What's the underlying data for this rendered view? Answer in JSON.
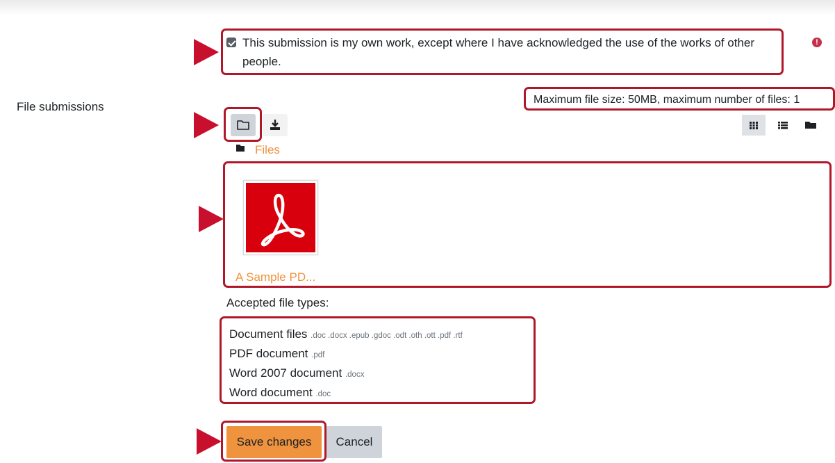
{
  "form": {
    "declaration_text": "This submission is my own work, except where I have acknowledged the use of the works of other people.",
    "declaration_checked": true,
    "field_label": "File submissions"
  },
  "filepicker": {
    "limits_text": "Maximum file size: 50MB, maximum number of files: 1",
    "toolbar": {
      "add_icon": "folder-outline-icon",
      "download_icon": "download-icon"
    },
    "views": {
      "icons_view_icon": "grid-icon",
      "list_view_icon": "list-icon",
      "tree_view_icon": "folder-icon",
      "active": "icons"
    },
    "breadcrumb": "Files",
    "files": [
      {
        "name": "A Sample PD...",
        "icon": "pdf-icon"
      }
    ]
  },
  "accepted": {
    "heading": "Accepted file types:",
    "types": [
      {
        "name": "Document files",
        "extensions": ".doc .docx .epub .gdoc .odt .oth .ott .pdf .rtf"
      },
      {
        "name": "PDF document",
        "extensions": ".pdf"
      },
      {
        "name": "Word 2007 document",
        "extensions": ".docx"
      },
      {
        "name": "Word document",
        "extensions": ".doc"
      }
    ]
  },
  "actions": {
    "save_label": "Save changes",
    "cancel_label": "Cancel"
  },
  "colors": {
    "accent": "#f0933e",
    "highlight_border": "#b0182a",
    "arrow": "#c8102e",
    "pdf_red": "#d9000d"
  }
}
